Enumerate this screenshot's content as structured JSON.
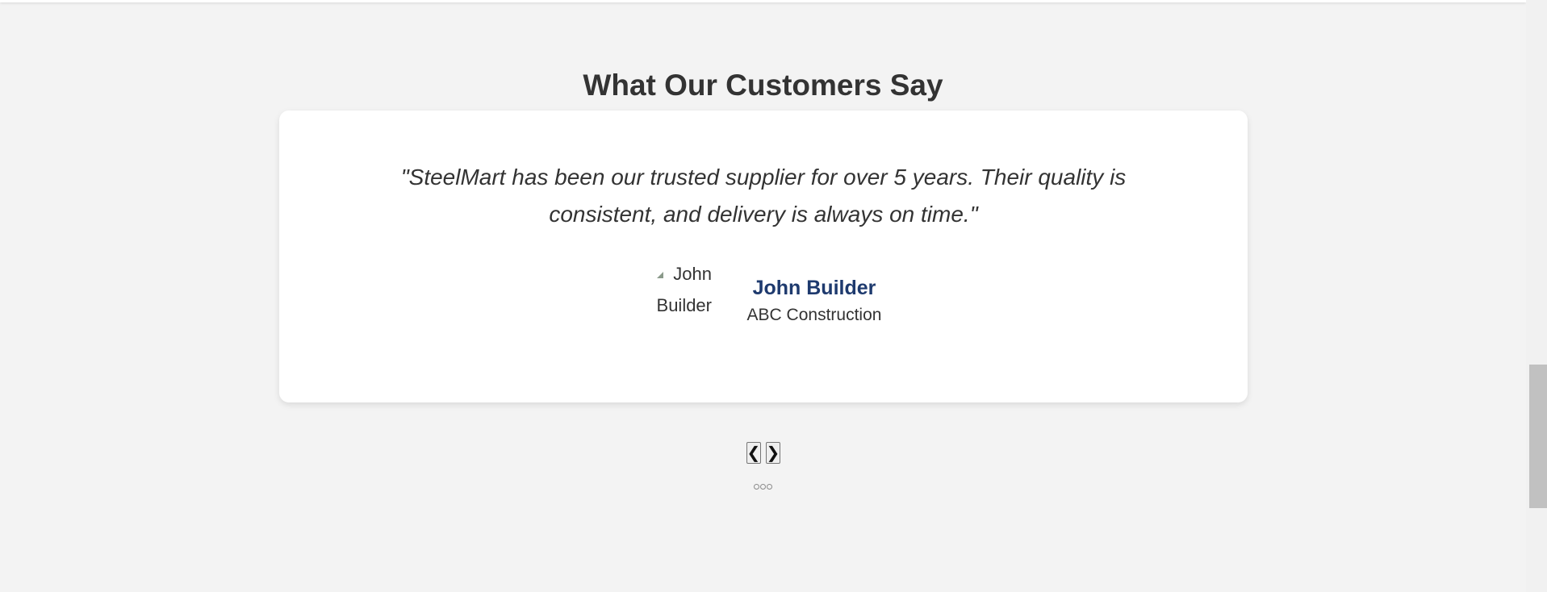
{
  "section": {
    "title": "What Our Customers Say"
  },
  "testimonial": {
    "quote": "\"SteelMart has been our trusted supplier for over 5 years. Their quality is consistent, and delivery is always on time.\"",
    "image_alt": "John Builder",
    "author_name": "John Builder",
    "author_company": "ABC Construction"
  },
  "navigation": {
    "prev_icon": "chevron-left-icon",
    "next_icon": "chevron-right-icon",
    "prev_glyph": "❮",
    "next_glyph": "❯",
    "dot_count": 3
  },
  "colors": {
    "background": "#f3f3f3",
    "card": "#ffffff",
    "title_text": "#333333",
    "author_name": "#1e3a6e"
  }
}
